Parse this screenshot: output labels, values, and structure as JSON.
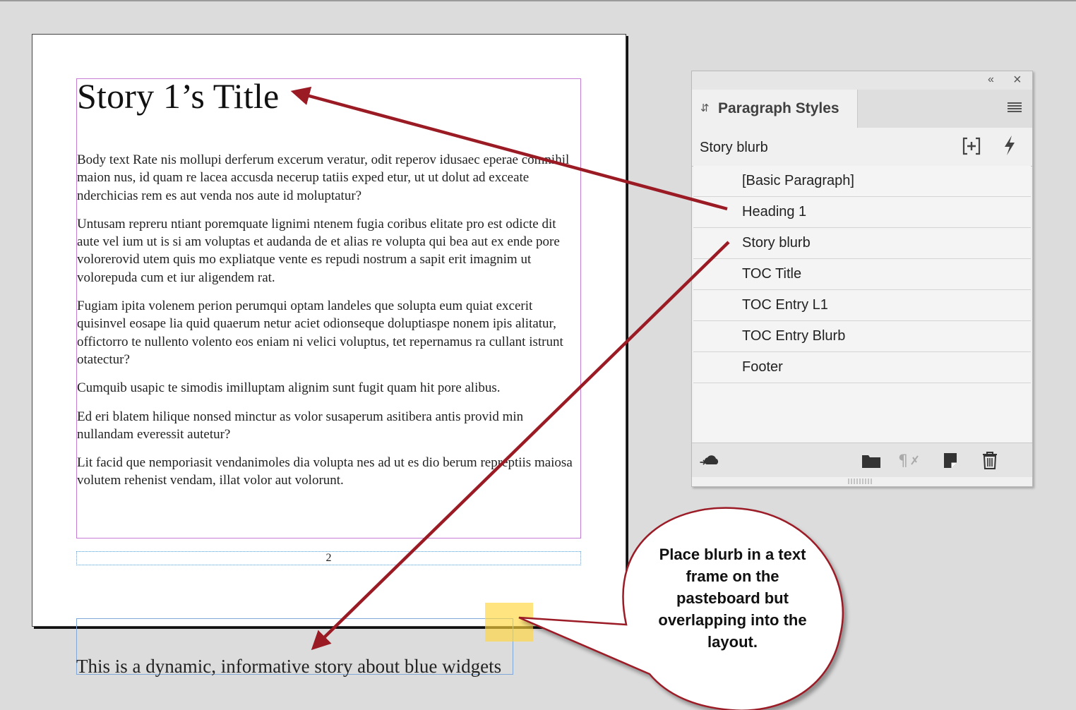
{
  "document": {
    "title": "Story 1’s Title",
    "paragraphs": [
      "Body text Rate nis mollupi derferum excerum veratur, odit reperov idusaec eperae comnihil maion nus, id quam re lacea accusda necerup tatiis exped etur, ut ut dolut ad exceate nderchicias rem es aut venda nos aute id moluptatur?",
      "Untusam repreru ntiant poremquate lignimi ntenem fugia coribus elitate pro est odicte dit aute vel ium ut is si am voluptas et audanda de et alias re volupta qui bea aut ex ende pore volorerovid utem quis mo expliatque vente es repudi nostrum a sapit erit imagnim ut volorepuda cum et iur aligendem rat.",
      "Fugiam ipita volenem perion perumqui optam landeles que solupta eum quiat excerit quisinvel eosape lia quid quaerum netur aciet odionseque doluptiaspe nonem ipis alitatur, offictorro te nullento volento eos eniam ni velici voluptus, tet repernamus ra cullant istrunt otatectur?",
      "Cumquib usapic te simodis imilluptam alignim sunt fugit quam hit pore alibus.",
      "Ed eri blatem hilique nonsed minctur as volor susaperum asitibera antis provid min nullandam everessit autetur?",
      "Lit facid que nemporiasit vendanimoles dia volupta nes ad ut es dio berum repreptiis maiosa volutem rehenist vendam, illat volor aut volorunt."
    ],
    "page_number": "2",
    "blurb": "This is a dynamic, informative story about blue widgets"
  },
  "panel": {
    "tab_label": "Paragraph Styles",
    "current_style": "Story blurb",
    "styles": [
      "[Basic Paragraph]",
      "Heading 1",
      "Story blurb",
      "TOC Title",
      "TOC Entry L1",
      "TOC Entry Blurb",
      "Footer"
    ]
  },
  "callout": {
    "text": "Place blurb in a text frame on the pasteboard but overlapping into the layout."
  },
  "colors": {
    "arrow": "#9b1b25",
    "frame_border": "#c47fd4",
    "blurb_frame_border": "#7fa8d8",
    "sticky_note": "#ffd63c"
  }
}
